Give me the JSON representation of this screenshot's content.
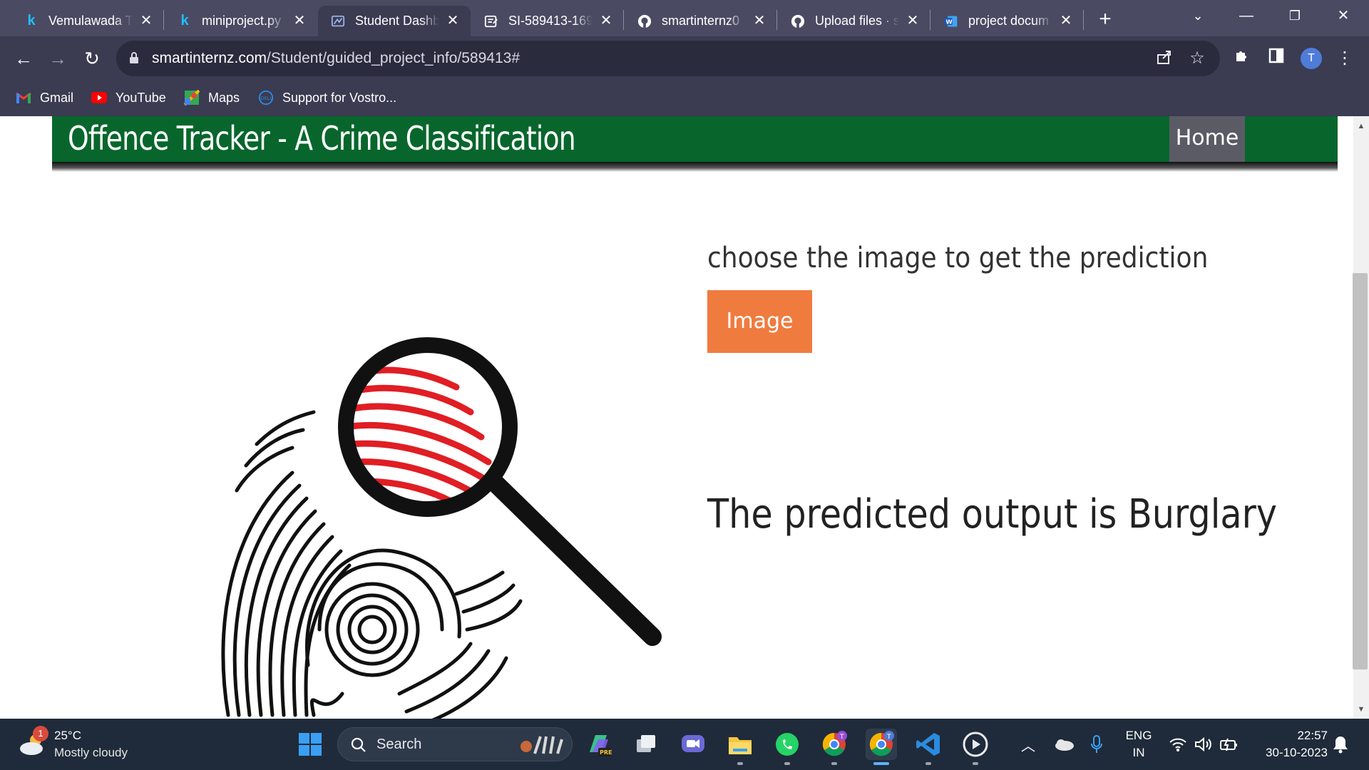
{
  "browser": {
    "tabs": [
      {
        "title": "Vemulawada T",
        "icon": "kaggle-icon"
      },
      {
        "title": "miniproject.py",
        "icon": "kaggle-icon"
      },
      {
        "title": "Student Dashb",
        "icon": "smartinternz-icon",
        "active": true
      },
      {
        "title": "SI-589413-169",
        "icon": "document-icon"
      },
      {
        "title": "smartinternz0",
        "icon": "github-icon"
      },
      {
        "title": "Upload files · s",
        "icon": "github-icon"
      },
      {
        "title": "project docum",
        "icon": "word-icon"
      }
    ],
    "url_host": "smartinternz.com",
    "url_path": "/Student/guided_project_info/589413#",
    "profile_initial": "T",
    "bookmarks": [
      {
        "label": "Gmail",
        "icon": "gmail-icon"
      },
      {
        "label": "YouTube",
        "icon": "youtube-icon"
      },
      {
        "label": "Maps",
        "icon": "maps-icon"
      },
      {
        "label": "Support for Vostro...",
        "icon": "dell-icon"
      }
    ]
  },
  "page": {
    "brand": "Offence Tracker - A Crime Classification",
    "nav_home": "Home",
    "prompt": "choose the image to get the prediction",
    "image_button": "Image",
    "result": "The predicted output is Burglary",
    "header_color": "#08662c",
    "button_color": "#f07b3f"
  },
  "taskbar": {
    "weather_temp": "25°C",
    "weather_condition": "Mostly cloudy",
    "weather_badge": "1",
    "search_label": "Search",
    "language_1": "ENG",
    "language_2": "IN",
    "time": "22:57",
    "date": "30-10-2023"
  }
}
